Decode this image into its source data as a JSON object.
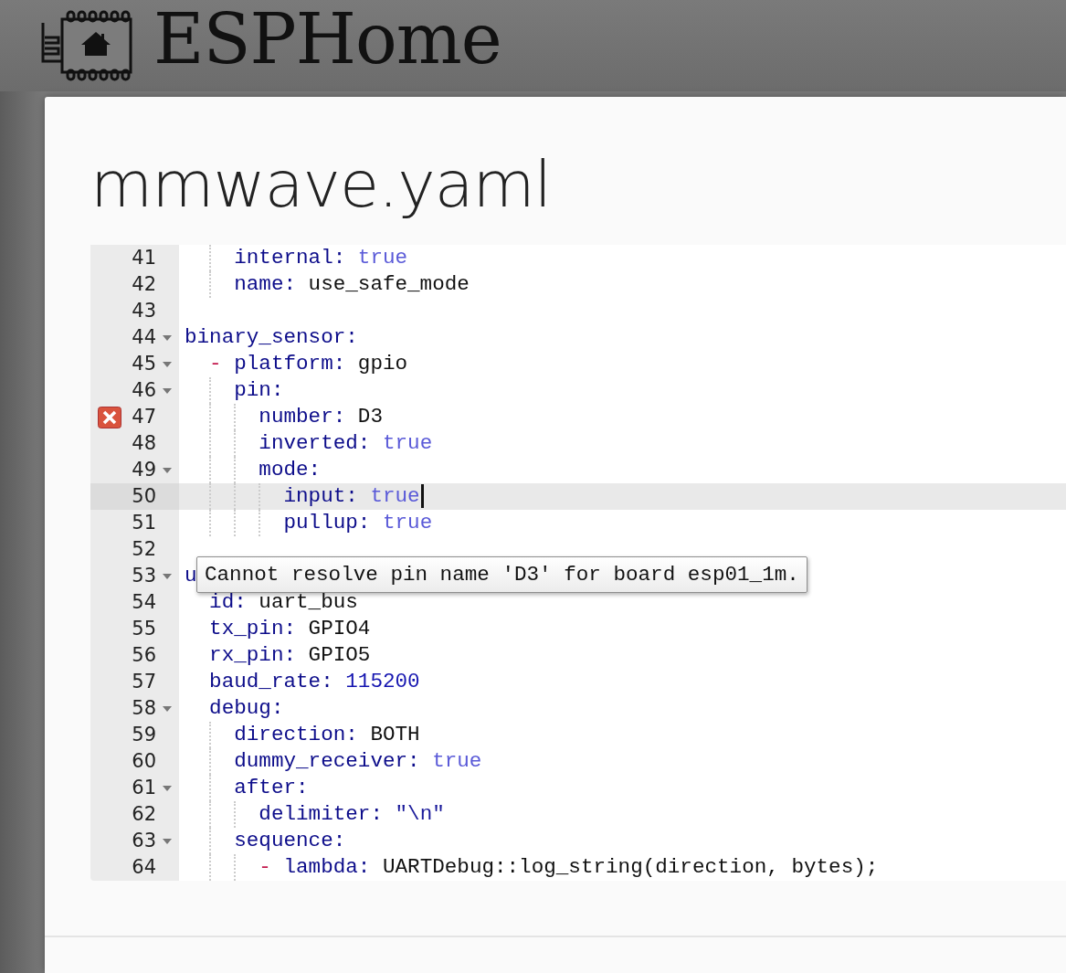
{
  "header": {
    "title": "ESPHome"
  },
  "dialog": {
    "title": "mmwave.yaml",
    "editor": {
      "lines": [
        {
          "number": "41",
          "foldable": false,
          "error": false,
          "active": false,
          "cursor": false,
          "tokens": [
            {
              "kind": "key",
              "text": "    internal:"
            },
            {
              "kind": "bool",
              "text": "true"
            }
          ]
        },
        {
          "number": "42",
          "foldable": false,
          "error": false,
          "active": false,
          "cursor": false,
          "tokens": [
            {
              "kind": "key",
              "text": "    name:"
            },
            {
              "kind": "plain",
              "text": "use_safe_mode"
            }
          ]
        },
        {
          "number": "43",
          "foldable": false,
          "error": false,
          "active": false,
          "cursor": false
        },
        {
          "number": "44",
          "foldable": true,
          "error": false,
          "active": false,
          "cursor": false,
          "tokens": [
            {
              "kind": "key",
              "text": "binary_sensor:"
            }
          ]
        },
        {
          "number": "45",
          "foldable": true,
          "error": false,
          "active": false,
          "cursor": false,
          "tokens": [
            {
              "kind": "dash",
              "text": "  -"
            },
            {
              "kind": "key",
              "text": "platform:"
            },
            {
              "kind": "plain",
              "text": "gpio"
            }
          ]
        },
        {
          "number": "46",
          "foldable": true,
          "error": false,
          "active": false,
          "cursor": false,
          "tokens": [
            {
              "kind": "key",
              "text": "    pin:"
            }
          ]
        },
        {
          "number": "47",
          "foldable": false,
          "error": true,
          "active": false,
          "cursor": false,
          "tokens": [
            {
              "kind": "key",
              "text": "      number:"
            },
            {
              "kind": "plain",
              "text": "D3"
            }
          ]
        },
        {
          "number": "48",
          "foldable": false,
          "error": false,
          "active": false,
          "cursor": false,
          "tokens": [
            {
              "kind": "key",
              "text": "      inverted:"
            },
            {
              "kind": "bool",
              "text": "true"
            }
          ]
        },
        {
          "number": "49",
          "foldable": true,
          "error": false,
          "active": false,
          "cursor": false,
          "tokens": [
            {
              "kind": "key",
              "text": "      mode:"
            }
          ]
        },
        {
          "number": "50",
          "foldable": false,
          "error": false,
          "active": true,
          "cursor": true,
          "tokens": [
            {
              "kind": "key",
              "text": "        input:"
            },
            {
              "kind": "bool",
              "text": "true"
            }
          ]
        },
        {
          "number": "51",
          "foldable": false,
          "error": false,
          "active": false,
          "cursor": false,
          "tokens": [
            {
              "kind": "key",
              "text": "        pullup:"
            },
            {
              "kind": "bool",
              "text": "true"
            }
          ]
        },
        {
          "number": "52",
          "foldable": false,
          "error": false,
          "active": false,
          "cursor": false
        },
        {
          "number": "53",
          "foldable": true,
          "error": false,
          "active": false,
          "cursor": false,
          "tokens": [
            {
              "kind": "key",
              "text": "u"
            }
          ],
          "tooltip": "Cannot resolve pin name 'D3' for board esp01_1m."
        },
        {
          "number": "54",
          "foldable": false,
          "error": false,
          "active": false,
          "cursor": false,
          "tokens": [
            {
              "kind": "key",
              "text": "  id:"
            },
            {
              "kind": "plain",
              "text": "uart_bus"
            }
          ]
        },
        {
          "number": "55",
          "foldable": false,
          "error": false,
          "active": false,
          "cursor": false,
          "tokens": [
            {
              "kind": "key",
              "text": "  tx_pin:"
            },
            {
              "kind": "plain",
              "text": "GPIO4"
            }
          ]
        },
        {
          "number": "56",
          "foldable": false,
          "error": false,
          "active": false,
          "cursor": false,
          "tokens": [
            {
              "kind": "key",
              "text": "  rx_pin:"
            },
            {
              "kind": "plain",
              "text": "GPIO5"
            }
          ]
        },
        {
          "number": "57",
          "foldable": false,
          "error": false,
          "active": false,
          "cursor": false,
          "tokens": [
            {
              "kind": "key",
              "text": "  baud_rate:"
            },
            {
              "kind": "number",
              "text": "115200"
            }
          ]
        },
        {
          "number": "58",
          "foldable": true,
          "error": false,
          "active": false,
          "cursor": false,
          "tokens": [
            {
              "kind": "key",
              "text": "  debug:"
            }
          ]
        },
        {
          "number": "59",
          "foldable": false,
          "error": false,
          "active": false,
          "cursor": false,
          "tokens": [
            {
              "kind": "key",
              "text": "    direction:"
            },
            {
              "kind": "plain",
              "text": "BOTH"
            }
          ]
        },
        {
          "number": "60",
          "foldable": false,
          "error": false,
          "active": false,
          "cursor": false,
          "tokens": [
            {
              "kind": "key",
              "text": "    dummy_receiver:"
            },
            {
              "kind": "bool",
              "text": "true"
            }
          ]
        },
        {
          "number": "61",
          "foldable": true,
          "error": false,
          "active": false,
          "cursor": false,
          "tokens": [
            {
              "kind": "key",
              "text": "    after:"
            }
          ]
        },
        {
          "number": "62",
          "foldable": false,
          "error": false,
          "active": false,
          "cursor": false,
          "tokens": [
            {
              "kind": "key",
              "text": "      delimiter:"
            },
            {
              "kind": "string",
              "text": "\"\\n\""
            }
          ]
        },
        {
          "number": "63",
          "foldable": true,
          "error": false,
          "active": false,
          "cursor": false,
          "tokens": [
            {
              "kind": "key",
              "text": "    sequence:"
            }
          ]
        },
        {
          "number": "64",
          "foldable": false,
          "error": false,
          "active": false,
          "cursor": false,
          "tokens": [
            {
              "kind": "dash",
              "text": "      -"
            },
            {
              "kind": "key",
              "text": "lambda:"
            },
            {
              "kind": "plain",
              "text": "UARTDebug::log_string(direction, bytes);"
            }
          ]
        }
      ]
    }
  }
}
